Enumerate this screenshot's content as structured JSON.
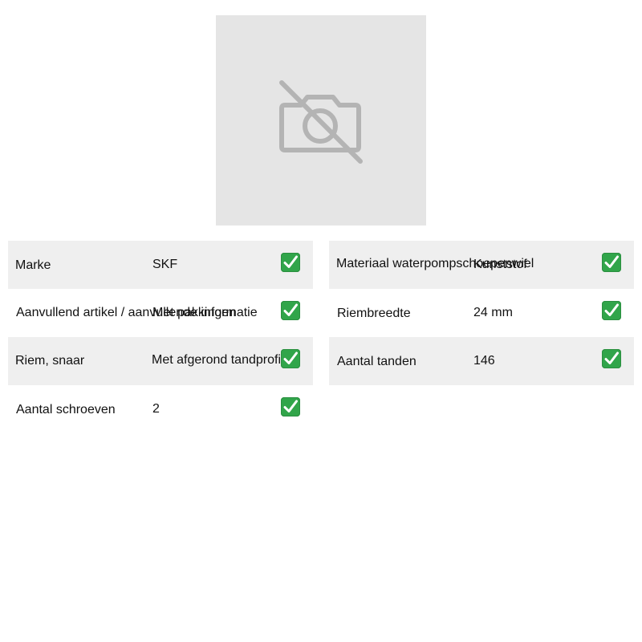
{
  "image_placeholder": {
    "icon": "no-photo-camera-icon"
  },
  "specs_left": [
    {
      "label": "Marke",
      "value": "SKF",
      "status_icon": "check-icon"
    },
    {
      "label": "Aanvullend artikel / aanvullende informatie",
      "value": "Met pakkingen",
      "status_icon": "check-icon"
    },
    {
      "label": "Riem, snaar",
      "value": "Met afgerond tandprofiel",
      "status_icon": "check-icon"
    },
    {
      "label": "Aantal schroeven",
      "value": "2",
      "status_icon": "check-icon"
    }
  ],
  "specs_right": [
    {
      "label": "Materiaal waterpompschoepenwiel",
      "value": "Kunststof",
      "status_icon": "check-icon"
    },
    {
      "label": "Riembreedte",
      "value": "24 mm",
      "status_icon": "check-icon"
    },
    {
      "label": "Aantal tanden",
      "value": "146",
      "status_icon": "check-icon"
    }
  ],
  "colors": {
    "row_shade": "#efefef",
    "check_green": "#31a54a",
    "placeholder_bg": "#e5e5e5"
  }
}
